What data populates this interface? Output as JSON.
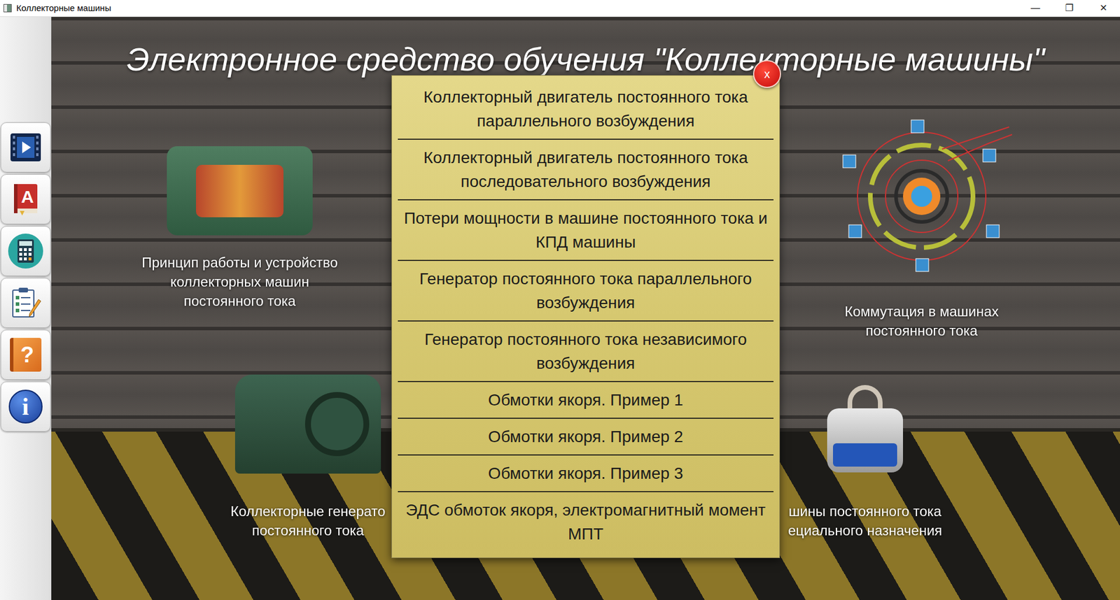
{
  "window": {
    "title": "Коллекторные машины",
    "controls": [
      "—",
      "❐",
      "✕"
    ]
  },
  "heading": "Электронное средство обучения \"Коллекторные машины\"",
  "sidebar": {
    "items": [
      {
        "kind": "video"
      },
      {
        "kind": "book",
        "glyph": "A"
      },
      {
        "kind": "calculator"
      },
      {
        "kind": "test"
      },
      {
        "kind": "help",
        "glyph": "?"
      },
      {
        "kind": "info",
        "glyph": "i"
      }
    ]
  },
  "cards": [
    {
      "kind": "motor",
      "caption": [
        "Принцип работы и устройство",
        "коллекторных машин",
        "постоянного тока"
      ]
    },
    {
      "kind": "commutation",
      "caption": [
        "Коммутация в машинах",
        "постоянного тока"
      ]
    },
    {
      "kind": "generator",
      "caption": [
        "Коллекторные генерато",
        "постоянного тока"
      ]
    },
    {
      "kind": "tachometer",
      "caption": [
        "шины постоянного тока",
        "ециального назначения"
      ]
    }
  ],
  "dialog": {
    "close": "x",
    "items": [
      "Коллекторный двигатель постоянного тока параллельного возбуждения",
      "Коллекторный двигатель постоянного тока последовательного возбуждения",
      "Потери мощности в машине постоянного тока и КПД машины",
      "Генератор постоянного тока параллельного возбуждения",
      "Генератор постоянного тока независимого возбуждения",
      "Обмотки якоря. Пример 1",
      "Обмотки якоря. Пример 2",
      "Обмотки якоря. Пример 3",
      "ЭДС обмоток якоря, электромагнитный момент МПТ"
    ]
  }
}
